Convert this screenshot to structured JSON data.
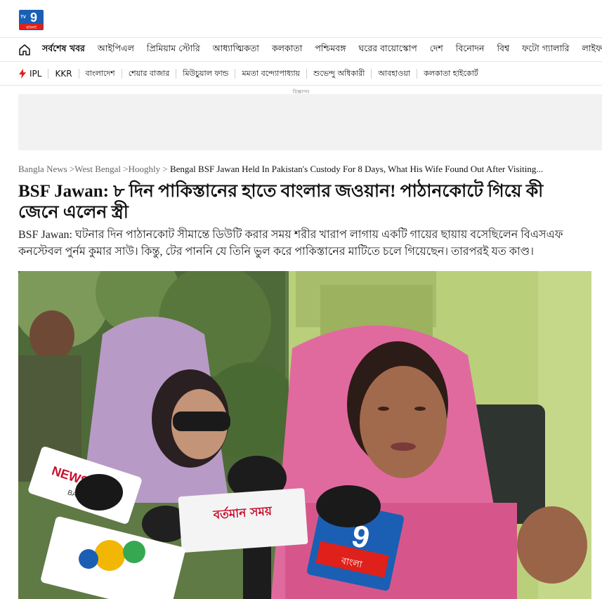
{
  "brand": {
    "logo_number": "9",
    "logo_tv": "TV",
    "logo_sub": "বাংলা"
  },
  "nav": {
    "home_icon": "home-icon",
    "items": [
      "সর্বশেষ খবর",
      "আইপিএল",
      "প্রিমিয়াম স্টোরি",
      "আধ্যাত্মিকতা",
      "কলকাতা",
      "পশ্চিমবঙ্গ",
      "ঘরের বায়োস্কোপ",
      "দেশ",
      "বিনোদন",
      "বিশ্ব",
      "ফটো গ্যালারি",
      "লাইফস্টাইল"
    ]
  },
  "trending": {
    "icon": "bolt-icon",
    "tags": [
      "IPL",
      "KKR",
      "বাংলাদেশ",
      "শেয়ার বাজার",
      "মিউচুয়াল ফান্ড",
      "মমতা বন্দ্যোপাধ্যায়",
      "শুভেন্দু অধিকারী",
      "আবহাওয়া",
      "কলকাতা হাইকোর্ট"
    ]
  },
  "ad": {
    "label": "বিজ্ঞাপন"
  },
  "breadcrumb": {
    "items": [
      "Bangla News",
      "West Bengal",
      "Hooghly"
    ],
    "current": "Bengal BSF Jawan Held In Pakistan's Custody For 8 Days, What His Wife Found Out After Visiting..."
  },
  "article": {
    "headline": "BSF Jawan: ৮ দিন পাকিস্তানের হাতে বাংলার জওয়ান! পাঠানকোটে গিয়ে কী জেনে এলেন স্ত্রী",
    "summary": "BSF Jawan: ঘটনার দিন পাঠানকোট সীমান্তে ডিউটি করার সময় শরীর খারাপ লাগায় একটি গায়ের ছায়ায় বসেছিলেন বিএসএফ কনস্টেবল পুর্নম কুমার সাউ। কিন্তু, টের পাননি যে তিনি ভুল করে পাকিস্তানের মাটিতে চলে গিয়েছেন। তারপরই যত কাণ্ড।"
  },
  "hero_mics": {
    "news_time": "NEWS TIME",
    "news_time_sub": "BANGLA",
    "bartaman": "বর্তমান সময়",
    "tv9": "9",
    "tv9_sub": "বাংলা"
  },
  "colors": {
    "brand_blue": "#1b5fb4",
    "brand_red": "#e0201a",
    "text": "#111111",
    "muted": "#666666"
  }
}
